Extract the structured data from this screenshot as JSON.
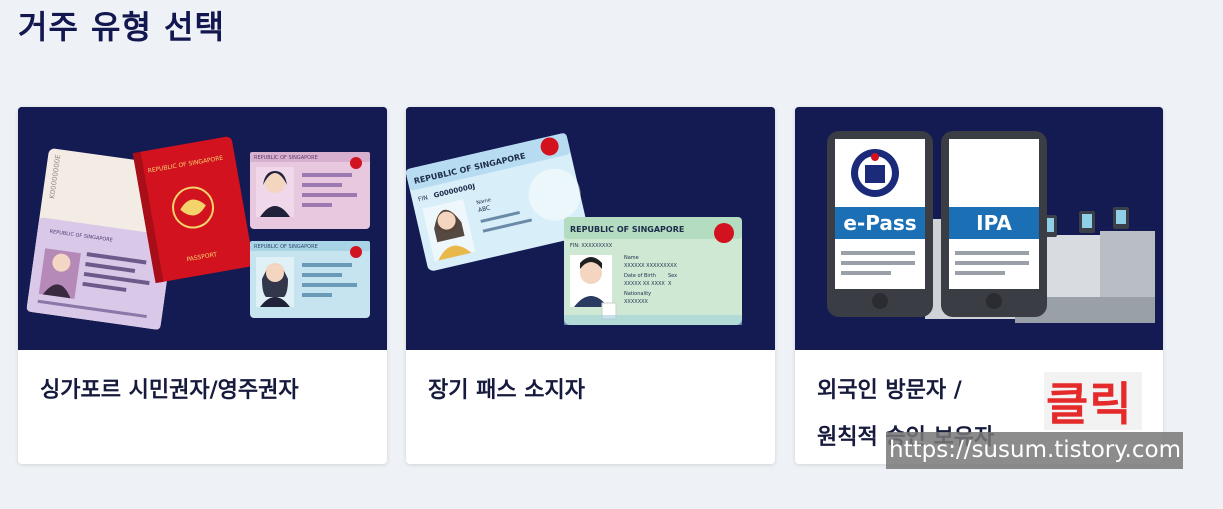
{
  "page": {
    "title": "거주 유형 선택"
  },
  "cards": [
    {
      "label": "싱가포르 시민권자/영주권자",
      "passport_text": "REPUBLIC OF SINGAPORE",
      "passport_bottom": "PASSPORT",
      "passport_number": "K00000000E",
      "id_header": "REPUBLIC OF SINGAPORE"
    },
    {
      "label": "장기 패스 소지자",
      "card_back_header": "REPUBLIC OF SINGAPORE",
      "card_back_fin_label": "FIN",
      "card_back_fin": "G0000000J",
      "card_back_name_label": "Name",
      "card_back_name": "ABC",
      "card_front_header": "REPUBLIC OF SINGAPORE",
      "card_front_fin": "FIN: XXXXXXXXX",
      "card_front_name_label": "Name",
      "card_front_name": "XXXXXX XXXXXXXXX",
      "card_front_dob_label": "Date of Birth",
      "card_front_sex_label": "Sex",
      "card_front_dob": "XXXXX XX XXXX",
      "card_front_sex": "X",
      "card_front_nat_label": "Nationality",
      "card_front_nat": "XXXXXXX"
    },
    {
      "label_line1": "외국인 방문자 /",
      "label_line2": "원칙적 승인 보유자",
      "phone1_label": "e-Pass",
      "phone2_label": "IPA"
    }
  ],
  "overlay": {
    "click_text": "클릭",
    "watermark": "https://susum.tistory.com"
  },
  "colors": {
    "page_bg": "#eef1f5",
    "card_image_bg": "#141a52",
    "title": "#12184f",
    "accent_blue": "#1b6fb5",
    "click_red": "#e42a2a"
  }
}
